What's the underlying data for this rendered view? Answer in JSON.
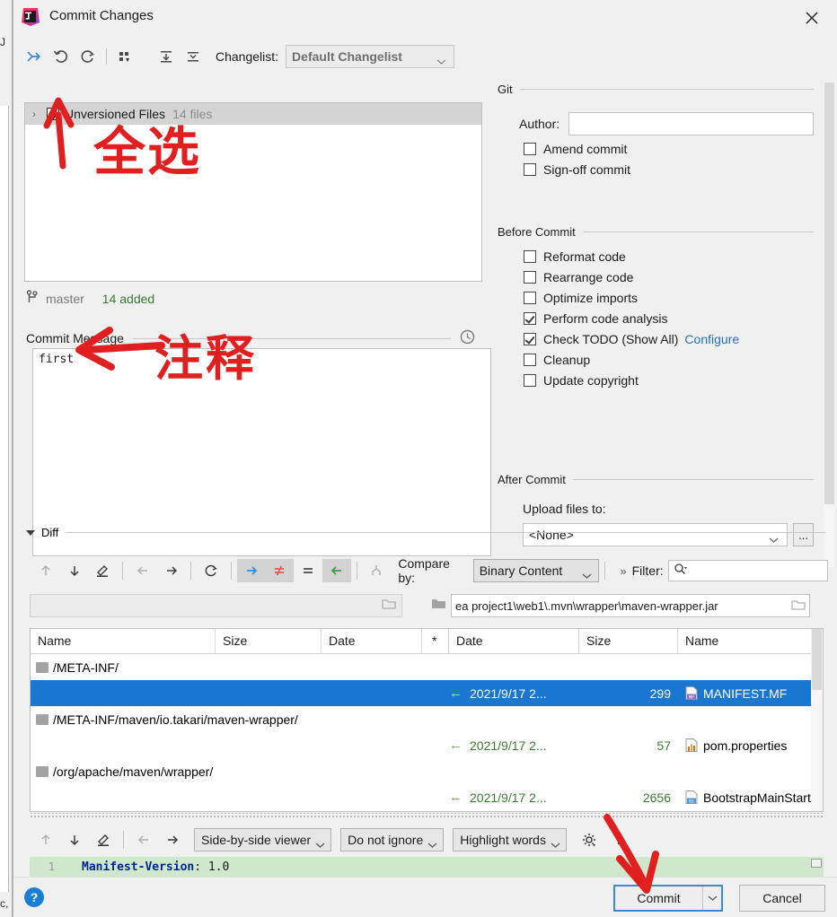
{
  "window": {
    "title": "Commit Changes",
    "app_icon": "intellij-idea-icon",
    "close_icon": "close-icon"
  },
  "changes_toolbar": {
    "buttons": [
      {
        "name": "collapse-selection-icon",
        "glyph": "arrows-in"
      },
      {
        "name": "rollback-icon",
        "glyph": "undo"
      },
      {
        "name": "refresh-icon",
        "glyph": "refresh"
      },
      {
        "name": "group-by-icon",
        "glyph": "grid"
      },
      {
        "name": "expand-all-icon",
        "glyph": "expand"
      },
      {
        "name": "collapse-all-icon",
        "glyph": "collapse"
      }
    ],
    "changelist_label": "Changelist:",
    "changelist_value": "Default Changelist"
  },
  "file_tree": {
    "expand_arrow": "›",
    "node_label": "Unversioned Files",
    "node_count": "14 files",
    "checked": true
  },
  "branch_bar": {
    "icon": "branch-icon",
    "branch": "master",
    "status": "14 added"
  },
  "commit_message": {
    "section_label": "Commit Message",
    "history_icon": "clock-icon",
    "value": "first",
    "placeholder": ""
  },
  "git_section": {
    "title": "Git",
    "author_label": "Author:",
    "author_value": "",
    "checkboxes": [
      {
        "label": "Amend commit",
        "checked": false
      },
      {
        "label": "Sign-off commit",
        "checked": false
      }
    ]
  },
  "before_commit": {
    "title": "Before Commit",
    "checkboxes": [
      {
        "label": "Reformat code",
        "checked": false
      },
      {
        "label": "Rearrange code",
        "checked": false
      },
      {
        "label": "Optimize imports",
        "checked": false
      },
      {
        "label": "Perform code analysis",
        "checked": true
      },
      {
        "label": "Check TODO (Show All)",
        "checked": true,
        "link": "Configure"
      },
      {
        "label": "Cleanup",
        "checked": false
      },
      {
        "label": "Update copyright",
        "checked": false
      }
    ]
  },
  "after_commit": {
    "title": "After Commit",
    "upload_label": "Upload files to:",
    "upload_value": "<None>",
    "ellipsis_label": "..."
  },
  "diff": {
    "section_label": "Diff",
    "toolbar_buttons": [
      {
        "name": "previous-difference-icon",
        "glyph": "↑",
        "state": "disabled"
      },
      {
        "name": "next-difference-icon",
        "glyph": "↓",
        "state": "enabled"
      },
      {
        "name": "edit-source-icon",
        "glyph": "pencil",
        "state": "enabled"
      },
      {
        "name": "previous-file-icon",
        "glyph": "←",
        "state": "disabled"
      },
      {
        "name": "next-file-icon",
        "glyph": "→",
        "state": "enabled"
      },
      {
        "name": "synchronize-icon",
        "glyph": "refresh",
        "state": "enabled"
      },
      {
        "name": "show-new-on-right-icon",
        "glyph": "→",
        "state": "toggled"
      },
      {
        "name": "show-difference-icon",
        "glyph": "≠",
        "state": "toggled"
      },
      {
        "name": "show-equal-icon",
        "glyph": "=",
        "state": "enabled"
      },
      {
        "name": "show-new-on-left-icon",
        "glyph": "←",
        "state": "toggled"
      },
      {
        "name": "compare-directories-icon",
        "glyph": "merge",
        "state": "disabled"
      }
    ],
    "compare_by_label": "Compare by:",
    "compare_by_value": "Binary Content",
    "filter_chevrons": "»",
    "filter_label": "Filter:",
    "filter_value": "",
    "path_left": "",
    "path_right": "ea project1\\web1\\.mvn\\wrapper\\maven-wrapper.jar",
    "browse_icon": "folder-open-icon"
  },
  "file_table": {
    "headers": [
      "Name",
      "Size",
      "Date",
      "*",
      "Date",
      "Size",
      "Name"
    ],
    "rows": [
      {
        "type": "folder",
        "name": "/META-INF/",
        "size": "",
        "date": "",
        "star": "",
        "rdate": "",
        "rsize": "",
        "rname": "",
        "selected": false
      },
      {
        "type": "file",
        "name": "",
        "size": "",
        "date": "",
        "star": "",
        "arrow": "←",
        "rdate": "2021/9/17 2...",
        "rsize": "299",
        "rname": "MANIFEST.MF",
        "ricon": "manifest-file-icon",
        "selected": true
      },
      {
        "type": "folder",
        "name": "/META-INF/maven/io.takari/maven-wrapper/",
        "size": "",
        "date": "",
        "star": "",
        "rdate": "",
        "rsize": "",
        "rname": "",
        "selected": false
      },
      {
        "type": "file",
        "name": "",
        "size": "",
        "date": "",
        "star": "",
        "arrow": "←",
        "rdate": "2021/9/17 2...",
        "rsize": "57",
        "rname": "pom.properties",
        "ricon": "properties-file-icon",
        "selected": false
      },
      {
        "type": "folder",
        "name": "/org/apache/maven/wrapper/",
        "size": "",
        "date": "",
        "star": "",
        "rdate": "",
        "rsize": "",
        "rname": "",
        "selected": false
      },
      {
        "type": "file",
        "name": "",
        "size": "",
        "date": "",
        "star": "",
        "arrow": "←",
        "rdate": "2021/9/17 2...",
        "rsize": "2656",
        "rname": "BootstrapMainStart...",
        "ricon": "class-file-icon",
        "selected": false
      }
    ]
  },
  "viewer_toolbar": {
    "buttons": [
      {
        "name": "previous-difference-icon",
        "glyph": "↑",
        "state": "disabled"
      },
      {
        "name": "next-difference-icon",
        "glyph": "↓",
        "state": "enabled"
      },
      {
        "name": "edit-source-icon",
        "glyph": "pencil",
        "state": "enabled"
      },
      {
        "name": "previous-change-icon",
        "glyph": "←",
        "state": "disabled"
      },
      {
        "name": "next-change-icon",
        "glyph": "→",
        "state": "enabled"
      }
    ],
    "viewer_mode": "Side-by-side viewer",
    "ignore_policy": "Do not ignore",
    "highlight_policy": "Highlight words",
    "settings_icon": "gear-icon",
    "help_glyph": "?"
  },
  "diff_preview": {
    "line_number": "1",
    "code_key": "Manifest-Version",
    "code_sep": ": ",
    "code_value": "1.0"
  },
  "footer": {
    "help_icon": "help-icon",
    "help_glyph": "?",
    "commit_label": "Commit",
    "commit_split_icon": "chevron-down-icon",
    "cancel_label": "Cancel"
  },
  "annotations": [
    {
      "name": "annotation-select-all",
      "text": "全选",
      "meaning": "select all"
    },
    {
      "name": "annotation-comment",
      "text": "注释",
      "meaning": "comment"
    }
  ],
  "colors": {
    "accent_blue": "#3d87d4",
    "selection_blue": "#1977d2",
    "link_blue": "#2470c4",
    "added_green": "#3a7a32",
    "diff_green_bg": "#cfe8cb",
    "annotation_red": "#e02020",
    "dialog_bg": "#f0f0f0"
  }
}
